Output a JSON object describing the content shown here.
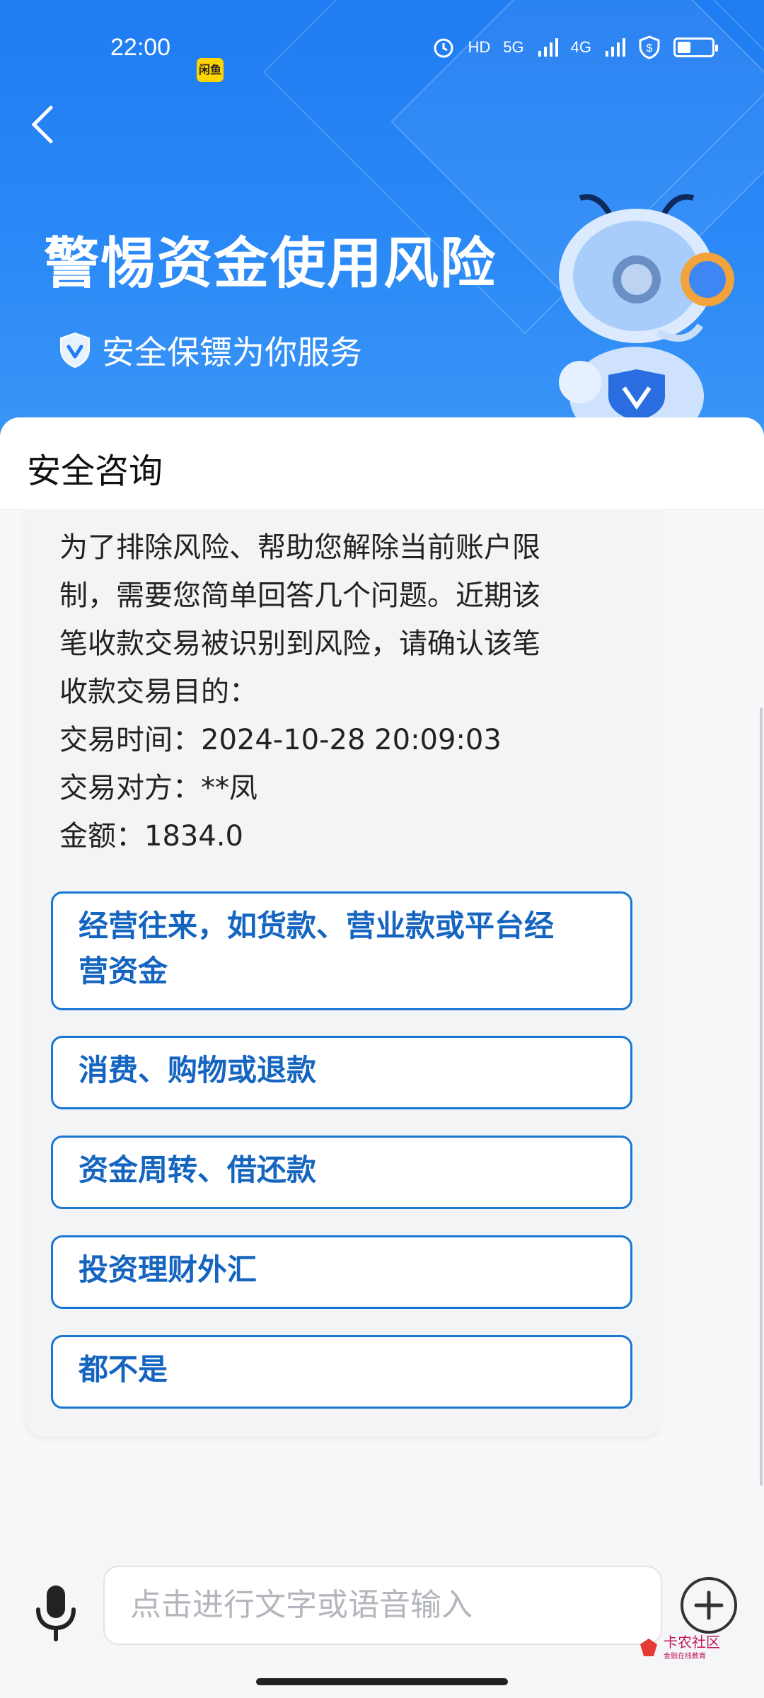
{
  "status_bar": {
    "time": "22:00",
    "app_badge": "闲鱼",
    "network_1": "5G",
    "network_2": "4G",
    "battery_percent": 40
  },
  "header": {
    "title": "警惕资金使用风险",
    "subtitle": "安全保镖为你服务"
  },
  "panel": {
    "title": "安全咨询",
    "message_lines": [
      "为了排除风险、帮助您解除当前账户限",
      "制，需要您简单回答几个问题。近期该",
      "笔收款交易被识别到风险，请确认该笔",
      "收款交易目的："
    ],
    "transaction": {
      "time_line": "交易时间：2024-10-28 20:09:03",
      "party_line": "交易对方：**凤",
      "amount_line": "金额：1834.0"
    },
    "options": [
      {
        "line1": "经营往来，如货款、营业款或平台经",
        "line2": "营资金"
      },
      {
        "line1": "消费、购物或退款"
      },
      {
        "line1": "资金周转、借还款"
      },
      {
        "line1": "投资理财外汇"
      },
      {
        "line1": "都不是"
      }
    ]
  },
  "input_bar": {
    "placeholder": "点击进行文字或语音输入"
  },
  "watermark": {
    "text": "卡农社区",
    "sub": "金融在线教育"
  },
  "colors": {
    "header_blue": "#1f7cf2",
    "option_border": "#1976d2",
    "option_text": "#1565c0"
  }
}
